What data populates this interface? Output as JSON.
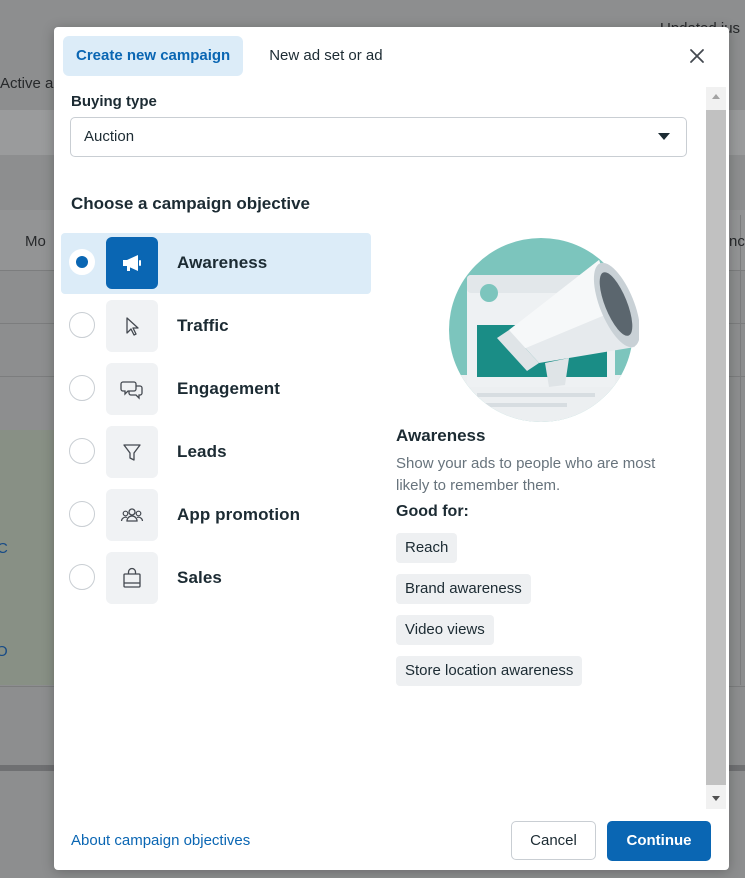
{
  "background": {
    "header_right_text": "Updated jus",
    "filter_text": "Active a",
    "column_left": "Mo",
    "column_right": "nc",
    "row_char_1": "C",
    "row_char_2": "O"
  },
  "modal": {
    "tabs": [
      {
        "label": "Create new campaign",
        "active": true
      },
      {
        "label": "New ad set or ad",
        "active": false
      }
    ],
    "buying_type": {
      "label": "Buying type",
      "value": "Auction"
    },
    "objective_heading": "Choose a campaign objective",
    "objectives": [
      {
        "label": "Awareness",
        "icon": "megaphone-icon",
        "selected": true
      },
      {
        "label": "Traffic",
        "icon": "cursor-icon",
        "selected": false
      },
      {
        "label": "Engagement",
        "icon": "chat-bubbles-icon",
        "selected": false
      },
      {
        "label": "Leads",
        "icon": "funnel-icon",
        "selected": false
      },
      {
        "label": "App promotion",
        "icon": "people-icon",
        "selected": false
      },
      {
        "label": "Sales",
        "icon": "shopping-bag-icon",
        "selected": false
      }
    ],
    "detail": {
      "title": "Awareness",
      "description": "Show your ads to people who are most likely to remember them.",
      "good_for_label": "Good for:",
      "tags": [
        "Reach",
        "Brand awareness",
        "Video views",
        "Store location awareness"
      ]
    },
    "footer": {
      "link": "About campaign objectives",
      "cancel": "Cancel",
      "continue": "Continue"
    }
  },
  "colors": {
    "accent": "#0a66b3",
    "selected_bg": "#dcecf8",
    "illustration_teal": "#7cc5bd"
  }
}
